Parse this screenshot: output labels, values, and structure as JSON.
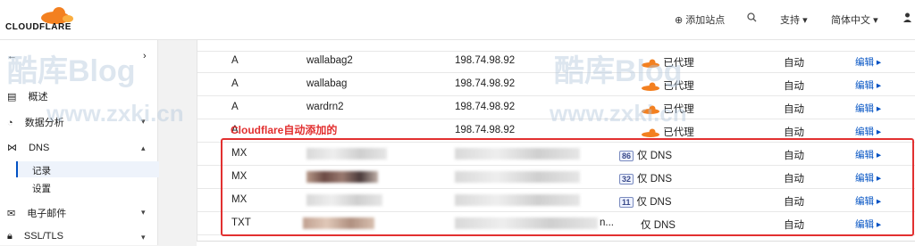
{
  "brand": {
    "logo_text": "CLOUDFLARE",
    "orange": "#f38020"
  },
  "topnav": {
    "add_site": "添加站点",
    "support": "支持",
    "language": "简体中文"
  },
  "sidebar": {
    "items": [
      {
        "label": "概述"
      },
      {
        "label": "数据分析"
      },
      {
        "label": "DNS"
      },
      {
        "label": "电子邮件"
      },
      {
        "label": "SSL/TLS"
      }
    ],
    "dns_sub": [
      "记录",
      "设置"
    ]
  },
  "watermark": {
    "blog": "酷库Blog",
    "url": "www.zxki.cn"
  },
  "annotation": "Cloudflare自动添加的",
  "records": [
    {
      "type": "A",
      "name": "wallabag2",
      "value": "198.74.98.92",
      "proxy": "已代理",
      "ttl": "自动",
      "edit": "编辑"
    },
    {
      "type": "A",
      "name": "wallabag",
      "value": "198.74.98.92",
      "proxy": "已代理",
      "ttl": "自动",
      "edit": "编辑"
    },
    {
      "type": "A",
      "name": "wardrn2",
      "value": "198.74.98.92",
      "proxy": "已代理",
      "ttl": "自动",
      "edit": "编辑"
    },
    {
      "type": "A",
      "name": "",
      "value": "198.74.98.92",
      "proxy": "已代理",
      "ttl": "自动",
      "edit": "编辑"
    },
    {
      "type": "MX",
      "priority": "86",
      "proxy": "仅 DNS",
      "ttl": "自动",
      "edit": "编辑"
    },
    {
      "type": "MX",
      "priority": "32",
      "proxy": "仅 DNS",
      "ttl": "自动",
      "edit": "编辑"
    },
    {
      "type": "MX",
      "priority": "11",
      "proxy": "仅 DNS",
      "ttl": "自动",
      "edit": "编辑"
    },
    {
      "type": "TXT",
      "value_suffix": "n...",
      "proxy": "仅 DNS",
      "ttl": "自动",
      "edit": "编辑"
    }
  ]
}
